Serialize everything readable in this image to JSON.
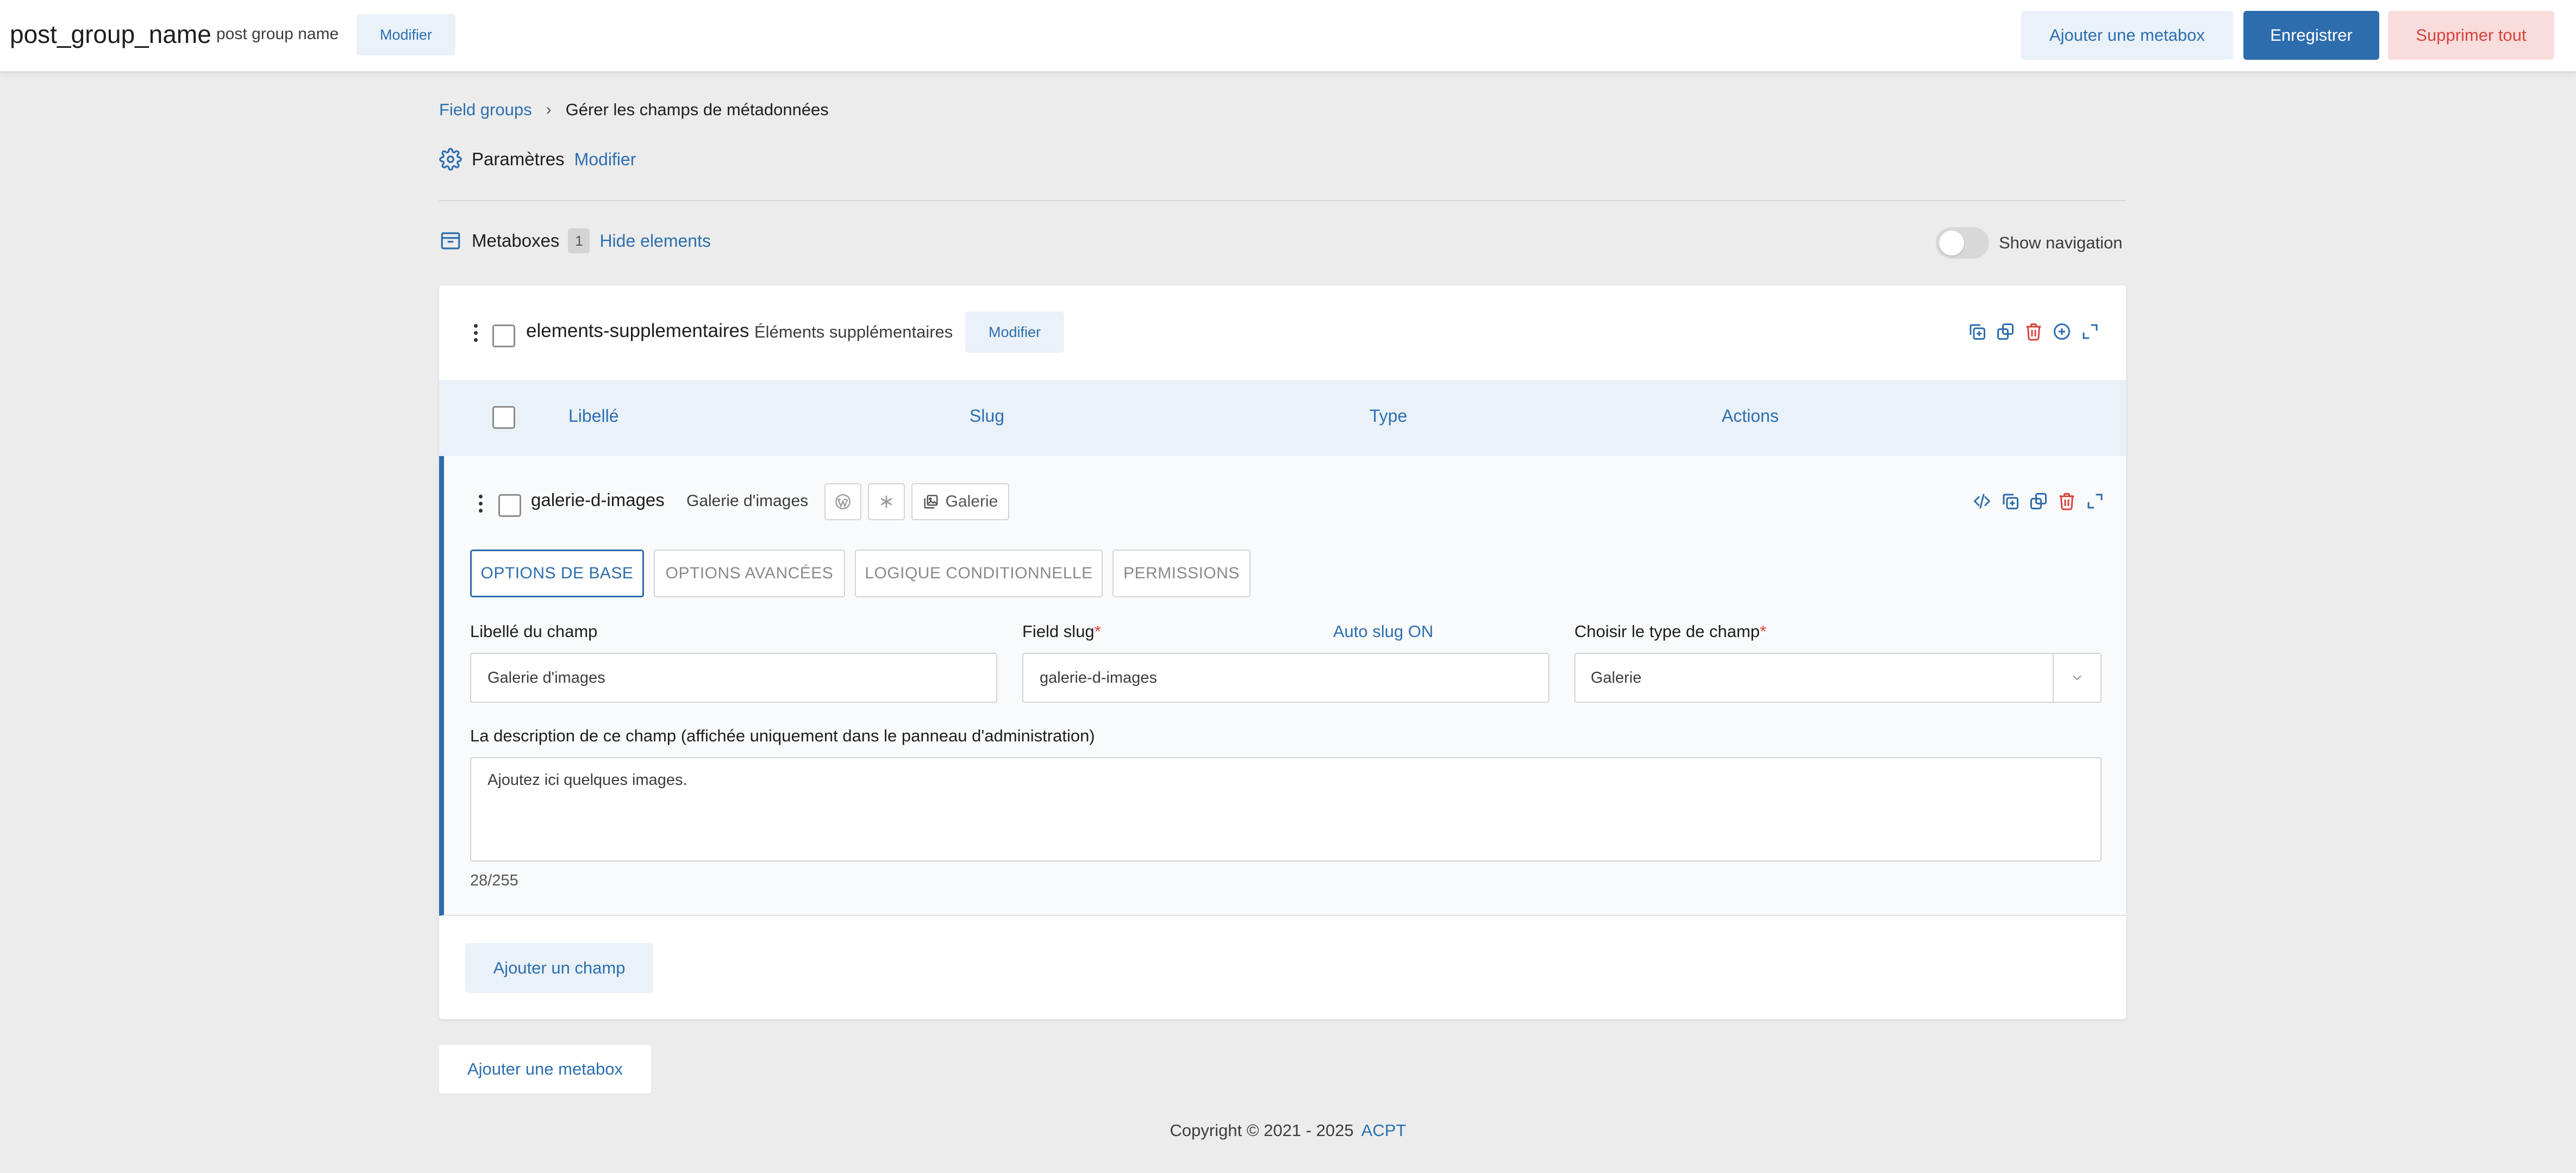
{
  "topbar": {
    "title": "post_group_name",
    "subtitle": "post group name",
    "modify_label": "Modifier",
    "add_metabox_label": "Ajouter une metabox",
    "save_label": "Enregistrer",
    "delete_all_label": "Supprimer tout"
  },
  "breadcrumb": {
    "root": "Field groups",
    "separator": "›",
    "current": "Gérer les champs de métadonnées"
  },
  "params": {
    "icon": "gear-icon",
    "label": "Paramètres",
    "link": "Modifier"
  },
  "metaboxes": {
    "icon": "archive-box-icon",
    "label": "Metaboxes",
    "count": "1",
    "hide_link": "Hide elements",
    "show_navigation_label": "Show navigation",
    "show_navigation_on": false
  },
  "metabox": {
    "name": "elements-supplementaires",
    "label": "Éléments supplémentaires",
    "modify_label": "Modifier",
    "actions": [
      "copy-plus-icon",
      "duplicate-icon",
      "trash-icon",
      "plus-circle-icon",
      "expand-icon"
    ]
  },
  "table": {
    "columns": [
      "Libellé",
      "Slug",
      "Type",
      "Actions"
    ]
  },
  "field": {
    "name": "galerie-d-images",
    "label": "Galerie d'images",
    "type_chip": "Galerie",
    "actions": [
      "code-icon",
      "copy-plus-icon",
      "duplicate-icon",
      "trash-icon",
      "expand-icon"
    ],
    "tabs": [
      "OPTIONS DE BASE",
      "OPTIONS AVANCÉES",
      "LOGIQUE CONDITIONNELLE",
      "PERMISSIONS"
    ],
    "active_tab": 0,
    "label_field": {
      "label": "Libellé du champ",
      "auto_slug": "Auto slug ON",
      "value": "Galerie d'images"
    },
    "slug_field": {
      "label": "Field slug",
      "required_mark": "*",
      "value": "galerie-d-images"
    },
    "type_field": {
      "label": "Choisir le type de champ",
      "required_mark": "*",
      "value": "Galerie"
    },
    "description": {
      "label": "La description de ce champ (affichée uniquement dans le panneau d'administration)",
      "value": "Ajoutez ici quelques images.",
      "counter": "28/255"
    }
  },
  "add_field_label": "Ajouter un champ",
  "add_metabox_bottom_label": "Ajouter une metabox",
  "footer": {
    "text": "Copyright © 2021 - 2025",
    "link": "ACPT"
  },
  "colors": {
    "accent": "#2d6cad",
    "link": "#2c6fb0",
    "danger": "#d6433c",
    "soft": "#eaf1f8",
    "background": "#ececec"
  }
}
